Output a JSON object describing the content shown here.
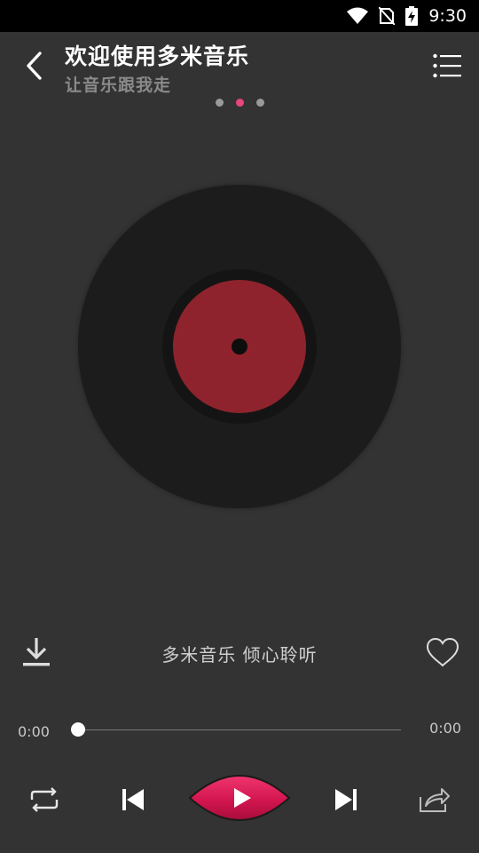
{
  "status_bar": {
    "time": "9:30",
    "icons": [
      "wifi-icon",
      "no-sim-icon",
      "battery-charging-icon"
    ]
  },
  "header": {
    "title": "欢迎使用多米音乐",
    "subtitle": "让音乐跟我走",
    "back_icon": "chevron-left-icon",
    "menu_icon": "list-menu-icon"
  },
  "pager": {
    "count": 3,
    "active_index": 1
  },
  "player": {
    "song_title": "多米音乐 倾心聆听",
    "current_time": "0:00",
    "total_time": "0:00",
    "progress": 0.0,
    "liked": false
  },
  "controls": {
    "repeat_icon": "repeat-icon",
    "prev_icon": "skip-previous-icon",
    "play_icon": "play-icon",
    "next_icon": "skip-next-icon",
    "share_icon": "share-icon",
    "download_icon": "download-icon",
    "like_icon": "heart-outline-icon"
  },
  "colors": {
    "background": "#333333",
    "accent": "#e8467c",
    "play_button": "#d3164f",
    "disc_label": "#8e232d"
  }
}
